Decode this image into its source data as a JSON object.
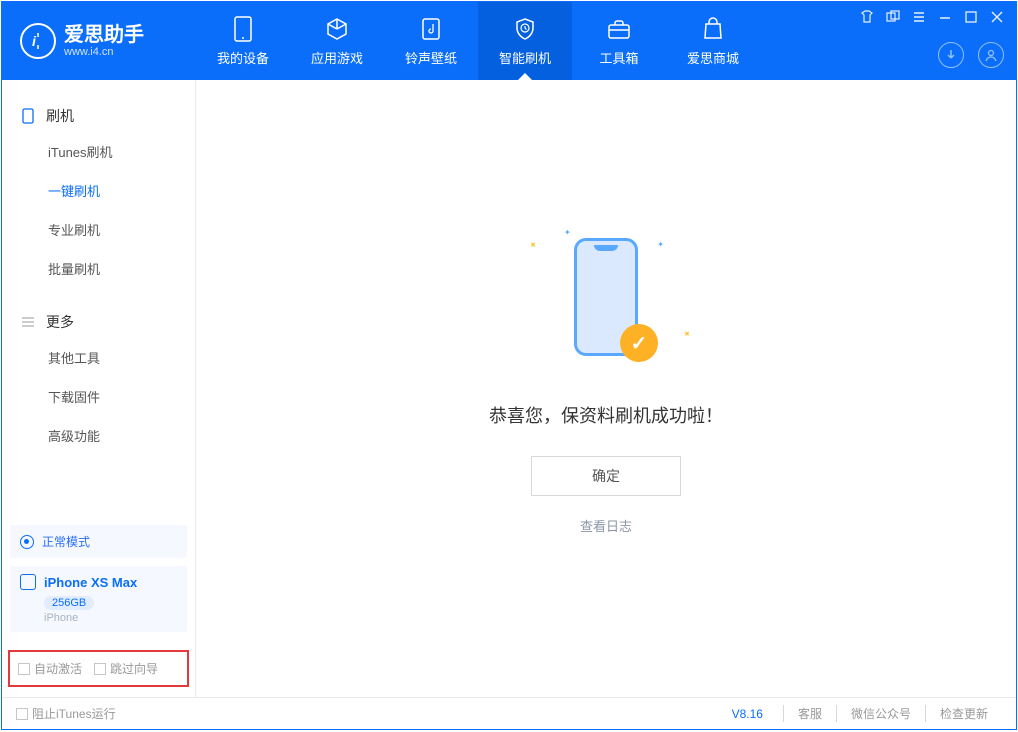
{
  "brand": {
    "title": "爱思助手",
    "subtitle": "www.i4.cn"
  },
  "nav": {
    "my_device": "我的设备",
    "app_games": "应用游戏",
    "ringtone_wallpaper": "铃声壁纸",
    "smart_flash": "智能刷机",
    "toolbox": "工具箱",
    "store": "爱思商城"
  },
  "sidebar": {
    "group_flash": "刷机",
    "itunes_flash": "iTunes刷机",
    "one_click_flash": "一键刷机",
    "pro_flash": "专业刷机",
    "batch_flash": "批量刷机",
    "group_more": "更多",
    "other_tools": "其他工具",
    "download_firmware": "下载固件",
    "advanced": "高级功能"
  },
  "status_mode": "正常模式",
  "device": {
    "name": "iPhone XS Max",
    "storage": "256GB",
    "type": "iPhone"
  },
  "check_auto_activate": "自动激活",
  "check_skip_guide": "跳过向导",
  "main": {
    "success_msg": "恭喜您，保资料刷机成功啦！",
    "ok": "确定",
    "view_log": "查看日志"
  },
  "footer": {
    "block_itunes": "阻止iTunes运行",
    "version": "V8.16",
    "support": "客服",
    "wechat": "微信公众号",
    "check_update": "检查更新"
  }
}
